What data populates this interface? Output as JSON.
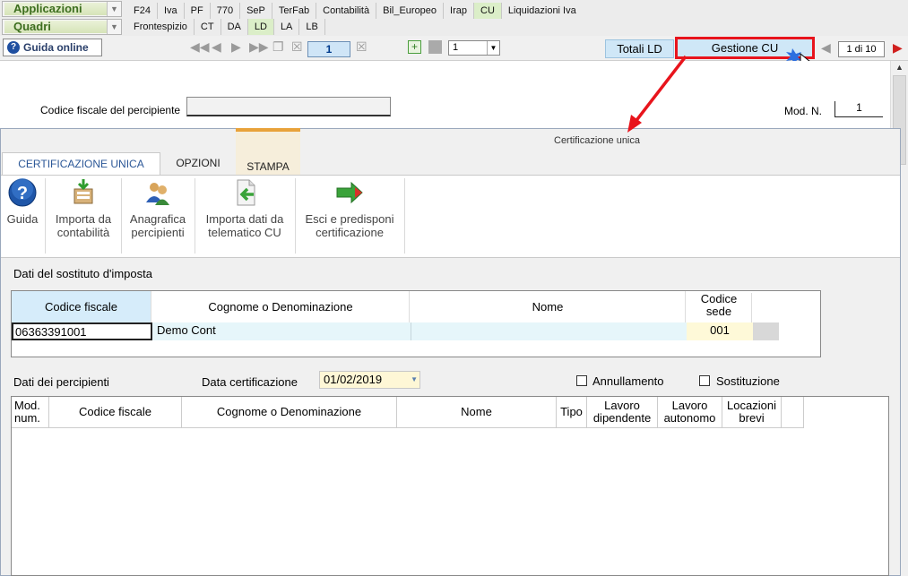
{
  "app": {
    "applicazioni_label": "Applicazioni",
    "quadri_label": "Quadri",
    "top_tabs": [
      "F24",
      "Iva",
      "PF",
      "770",
      "SeP",
      "TerFab",
      "Contabilità",
      "Bil_Europeo",
      "Irap",
      "CU",
      "Liquidazioni Iva"
    ],
    "top_tab_active": "CU",
    "quadri_tabs": [
      "Frontespizio",
      "CT",
      "DA",
      "LD",
      "LA",
      "LB"
    ],
    "quadri_tab_active": "LD"
  },
  "toolbar": {
    "guida_online": "Guida online",
    "page_value": "1",
    "zoom_value": "1",
    "totali_ld": "Totali LD",
    "gestione_cu": "Gestione CU",
    "page_count": "1 di 10"
  },
  "background_form": {
    "cf_percipiente_label": "Codice fiscale del percipiente",
    "cf_percipiente_value": "",
    "mod_n_label": "Mod. N.",
    "mod_n_value": "1"
  },
  "dialog": {
    "title": "Certificazione unica",
    "tabs": [
      "CERTIFICAZIONE UNICA",
      "OPZIONI",
      "STAMPA"
    ],
    "ribbon": {
      "guida": "Guida",
      "importa_contabilita": [
        "Importa da",
        "contabilità"
      ],
      "anagrafica_percipienti": [
        "Anagrafica",
        "percipienti"
      ],
      "importa_telematico": [
        "Importa dati da",
        "telematico CU"
      ],
      "esci_predisponi": [
        "Esci e predisponi",
        "certificazione"
      ]
    },
    "sostituto": {
      "section_label": "Dati del sostituto d'imposta",
      "headers": {
        "codice_fiscale": "Codice fiscale",
        "cognome": "Cognome o Denominazione",
        "nome": "Nome",
        "codice_sede": [
          "Codice",
          "sede"
        ]
      },
      "row": {
        "codice_fiscale": "06363391001",
        "cognome": "Demo Cont",
        "nome": "",
        "codice_sede": "001"
      }
    },
    "percipienti": {
      "section_label": "Dati dei percipienti",
      "data_cert_label": "Data certificazione",
      "data_cert_value": "01/02/2019",
      "annullamento_label": "Annullamento",
      "sostituzione_label": "Sostituzione",
      "annullamento_checked": false,
      "sostituzione_checked": false,
      "columns": [
        [
          "Mod.",
          "num."
        ],
        [
          "Codice fiscale"
        ],
        [
          "Cognome o Denominazione"
        ],
        [
          "Nome"
        ],
        [
          "Tipo"
        ],
        [
          "Lavoro",
          "dipendente"
        ],
        [
          "Lavoro",
          "autonomo"
        ],
        [
          "Locazioni",
          "brevi"
        ]
      ],
      "rows": []
    }
  },
  "colors": {
    "highlight_red": "#e8141c",
    "active_tab_green": "#dbeec8",
    "blue_button": "#cfe7f7"
  }
}
